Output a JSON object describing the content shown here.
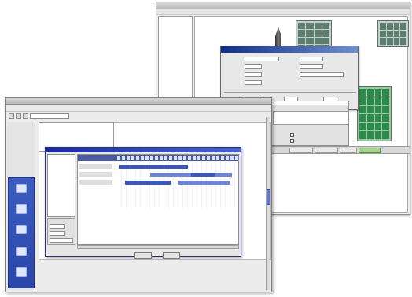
{
  "back_window": {
    "left_panel_items": [
      "",
      "",
      ""
    ],
    "props_dialog": {
      "title": "",
      "fields": [
        {
          "label": "",
          "value": ""
        },
        {
          "label": "",
          "value": ""
        },
        {
          "label": "",
          "value": ""
        },
        {
          "label": "",
          "value": ""
        }
      ]
    },
    "checkboxes": [
      "",
      ""
    ],
    "status_segments": [
      "",
      "",
      "",
      ""
    ]
  },
  "front_window": {
    "menus": [
      "",
      "",
      "",
      "",
      "",
      ""
    ],
    "nav_labels": [
      "",
      "",
      ""
    ],
    "tree_items": [
      "",
      "",
      ""
    ],
    "gantt_list": [
      "",
      "",
      ""
    ],
    "gantt_rows": [
      "",
      "",
      ""
    ],
    "buttons": [
      "",
      ""
    ]
  },
  "colors": {
    "accent_blue": "#2a46a8",
    "rack_green": "#2e8a4a",
    "title_blue": "#1b2b98"
  }
}
